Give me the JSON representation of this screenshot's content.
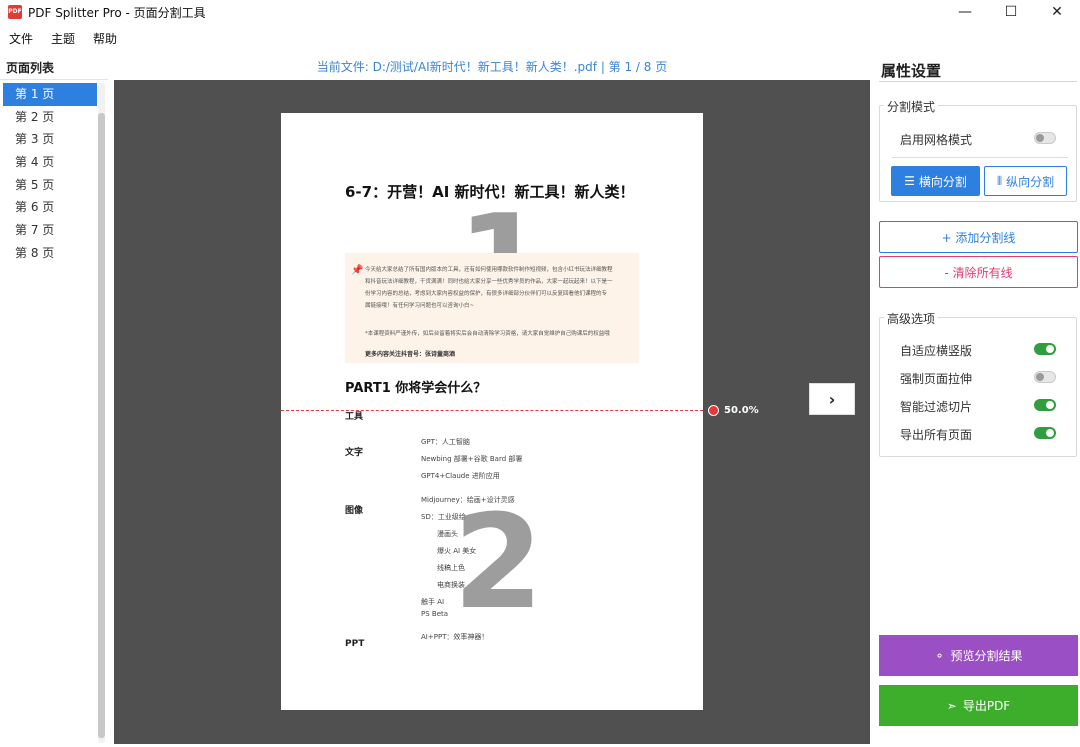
{
  "titlebar": {
    "icon_text": "PDF",
    "title": "PDF Splitter Pro - 页面分割工具",
    "minimize": "—",
    "maximize": "☐",
    "close": "✕"
  },
  "menu": [
    "文件",
    "主题",
    "帮助"
  ],
  "left_panel": {
    "header": "页面列表",
    "pages": [
      "第 1 页",
      "第 2 页",
      "第 3 页",
      "第 4 页",
      "第 5 页",
      "第 6 页",
      "第 7 页",
      "第 8 页"
    ],
    "selected_index": 0
  },
  "center": {
    "file_info": "当前文件: D:/测试/AI新时代！新工具！新人类！.pdf  |  第 1 / 8 页",
    "split_percent": "50.0%",
    "next_label": "›",
    "page": {
      "title": "6-7：开营！AI 新时代！新工具！新人类！",
      "region_1_label": "1",
      "region_2_label": "2",
      "note_lines": [
        "今天给大家总结了所有国内版本的工具，还有如何使用哪款软件制作短视频，包含小红书玩法详细教程",
        "和抖音玩法详细教程，干货满满！同时也给大家分享一些优秀学员的作品，大家一起玩起来！以下是一",
        "份学习内容的总结，考虑到大家内容权益的保护，有很多详细部分伙伴们可以反复回看他们课程的专",
        "属链接哦！有任何学习问题也可以咨询小白~"
      ],
      "note_footer": "*本课程资料严谨外传，如后台留着将实后会自动清除学习资格，请大家自觉维护自己购课后的权益哦",
      "note_bold": "更多内容关注抖音号：张诗童商酒",
      "part_title": "PART1 你将学会什么？",
      "sections": [
        {
          "label": "工具",
          "lines": []
        },
        {
          "label": "文字",
          "lines": [
            "GPT：人工智脑",
            "Newbing 部署+谷歌 Bard 部署",
            "GPT4+Claude 进阶应用"
          ]
        },
        {
          "label": "图像",
          "lines": [
            "Midjourney：绘画+设计灵感",
            "SD：工业级绘",
            "漫画头",
            "爆火 AI 美女",
            "线稿上色",
            "电商换装",
            "触手 AI",
            "PS Beta"
          ]
        },
        {
          "label": "PPT",
          "lines": [
            "AI+PPT：效率神器！"
          ]
        }
      ]
    }
  },
  "right_panel": {
    "title": "属性设置",
    "split_mode": {
      "label": "分割模式",
      "grid_mode_label": "启用网格模式",
      "grid_mode_on": false,
      "horizontal_label": "横向分割",
      "vertical_label": "纵向分割"
    },
    "add_line_label": "+ 添加分割线",
    "clear_lines_label": "- 清除所有线",
    "advanced": {
      "label": "高级选项",
      "options": [
        {
          "label": "自适应横竖版",
          "on": true
        },
        {
          "label": "强制页面拉伸",
          "on": false
        },
        {
          "label": "智能过滤切片",
          "on": true
        },
        {
          "label": "导出所有页面",
          "on": true
        }
      ]
    },
    "preview_label": "预览分割结果",
    "export_label": "导出PDF"
  }
}
